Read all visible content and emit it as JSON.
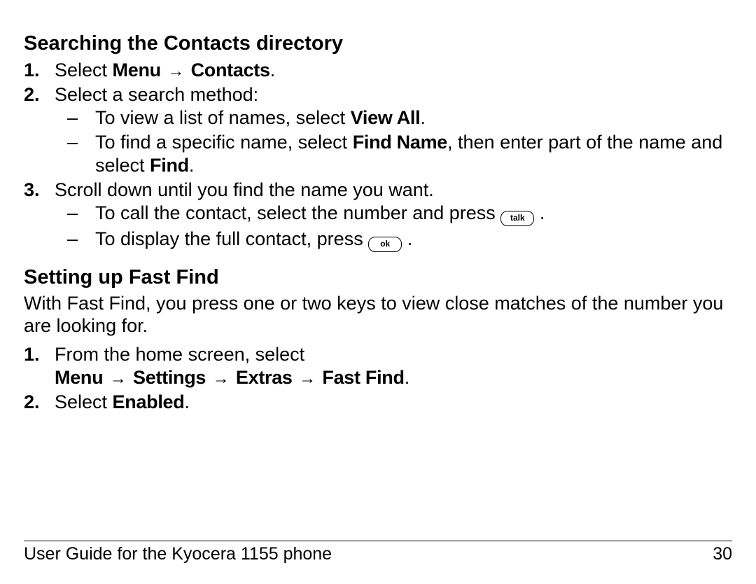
{
  "section1": {
    "heading": "Searching the Contacts directory",
    "steps": [
      {
        "pre": "Select ",
        "bold1": "Menu",
        "arrow1": "→",
        "bold2": "Contacts",
        "post": "."
      },
      {
        "text": "Select a search method:",
        "sub": [
          {
            "pre": "To view a list of names, select ",
            "bold": "View All",
            "post": "."
          },
          {
            "pre": "To find a specific name, select ",
            "bold1": "Find Name",
            "mid": ", then enter part of the name and select ",
            "bold2": "Find",
            "post": "."
          }
        ]
      },
      {
        "text": "Scroll down until you find the name you want.",
        "sub": [
          {
            "pre": "To call the contact, select the number and press ",
            "key": "talk",
            "post": "."
          },
          {
            "pre": "To display the full contact, press ",
            "key": "ok",
            "post": "."
          }
        ]
      }
    ]
  },
  "section2": {
    "heading": "Setting up Fast Find",
    "intro": "With Fast Find, you press one or two keys to view close matches of the number you are looking for.",
    "steps": [
      {
        "line1": "From the home screen, select",
        "bold_seq": [
          "Menu",
          "Settings",
          "Extras",
          "Fast Find"
        ],
        "arrow": "→",
        "end": "."
      },
      {
        "pre": "Select ",
        "bold": "Enabled",
        "post": "."
      }
    ]
  },
  "footer": {
    "left": "User Guide for the Kyocera 1155 phone",
    "right": "30"
  }
}
